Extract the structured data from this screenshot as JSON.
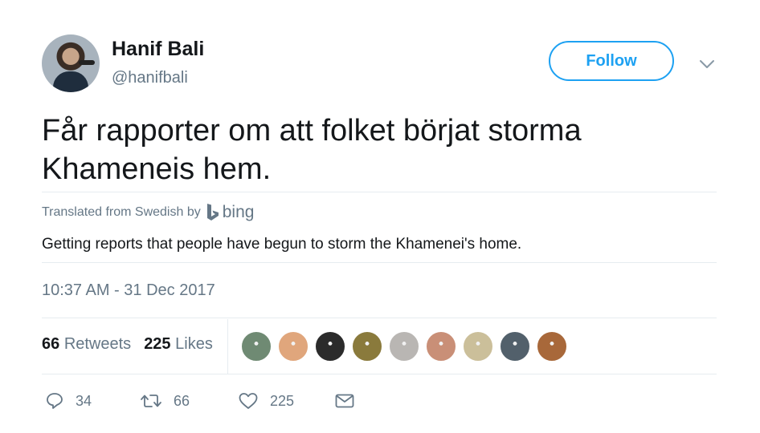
{
  "user": {
    "name": "Hanif Bali",
    "handle": "@hanifbali",
    "follow_label": "Follow"
  },
  "tweet": {
    "text": "Får rapporter om att folket börjat storma Khameneis hem.",
    "translated_from": "Translated from Swedish by",
    "translator": "bing",
    "translation": "Getting reports that people have begun to storm the Khamenei's home.",
    "timestamp": "10:37 AM - 31 Dec 2017"
  },
  "stats": {
    "retweets_count": "66",
    "retweets_label": "Retweets",
    "likes_count": "225",
    "likes_label": "Likes"
  },
  "likers": [
    {
      "color": "#6f8a73"
    },
    {
      "color": "#e0a67c"
    },
    {
      "color": "#2b2b2b"
    },
    {
      "color": "#8a7a3c"
    },
    {
      "color": "#b9b6b3"
    },
    {
      "color": "#c98f77"
    },
    {
      "color": "#cbbf9a"
    },
    {
      "color": "#52606b"
    },
    {
      "color": "#a8683a"
    }
  ],
  "actions": {
    "replies": "34",
    "retweets": "66",
    "likes": "225"
  },
  "colors": {
    "accent": "#1da1f2",
    "muted": "#657786",
    "text": "#14171a",
    "divider": "#e6ecf0"
  }
}
